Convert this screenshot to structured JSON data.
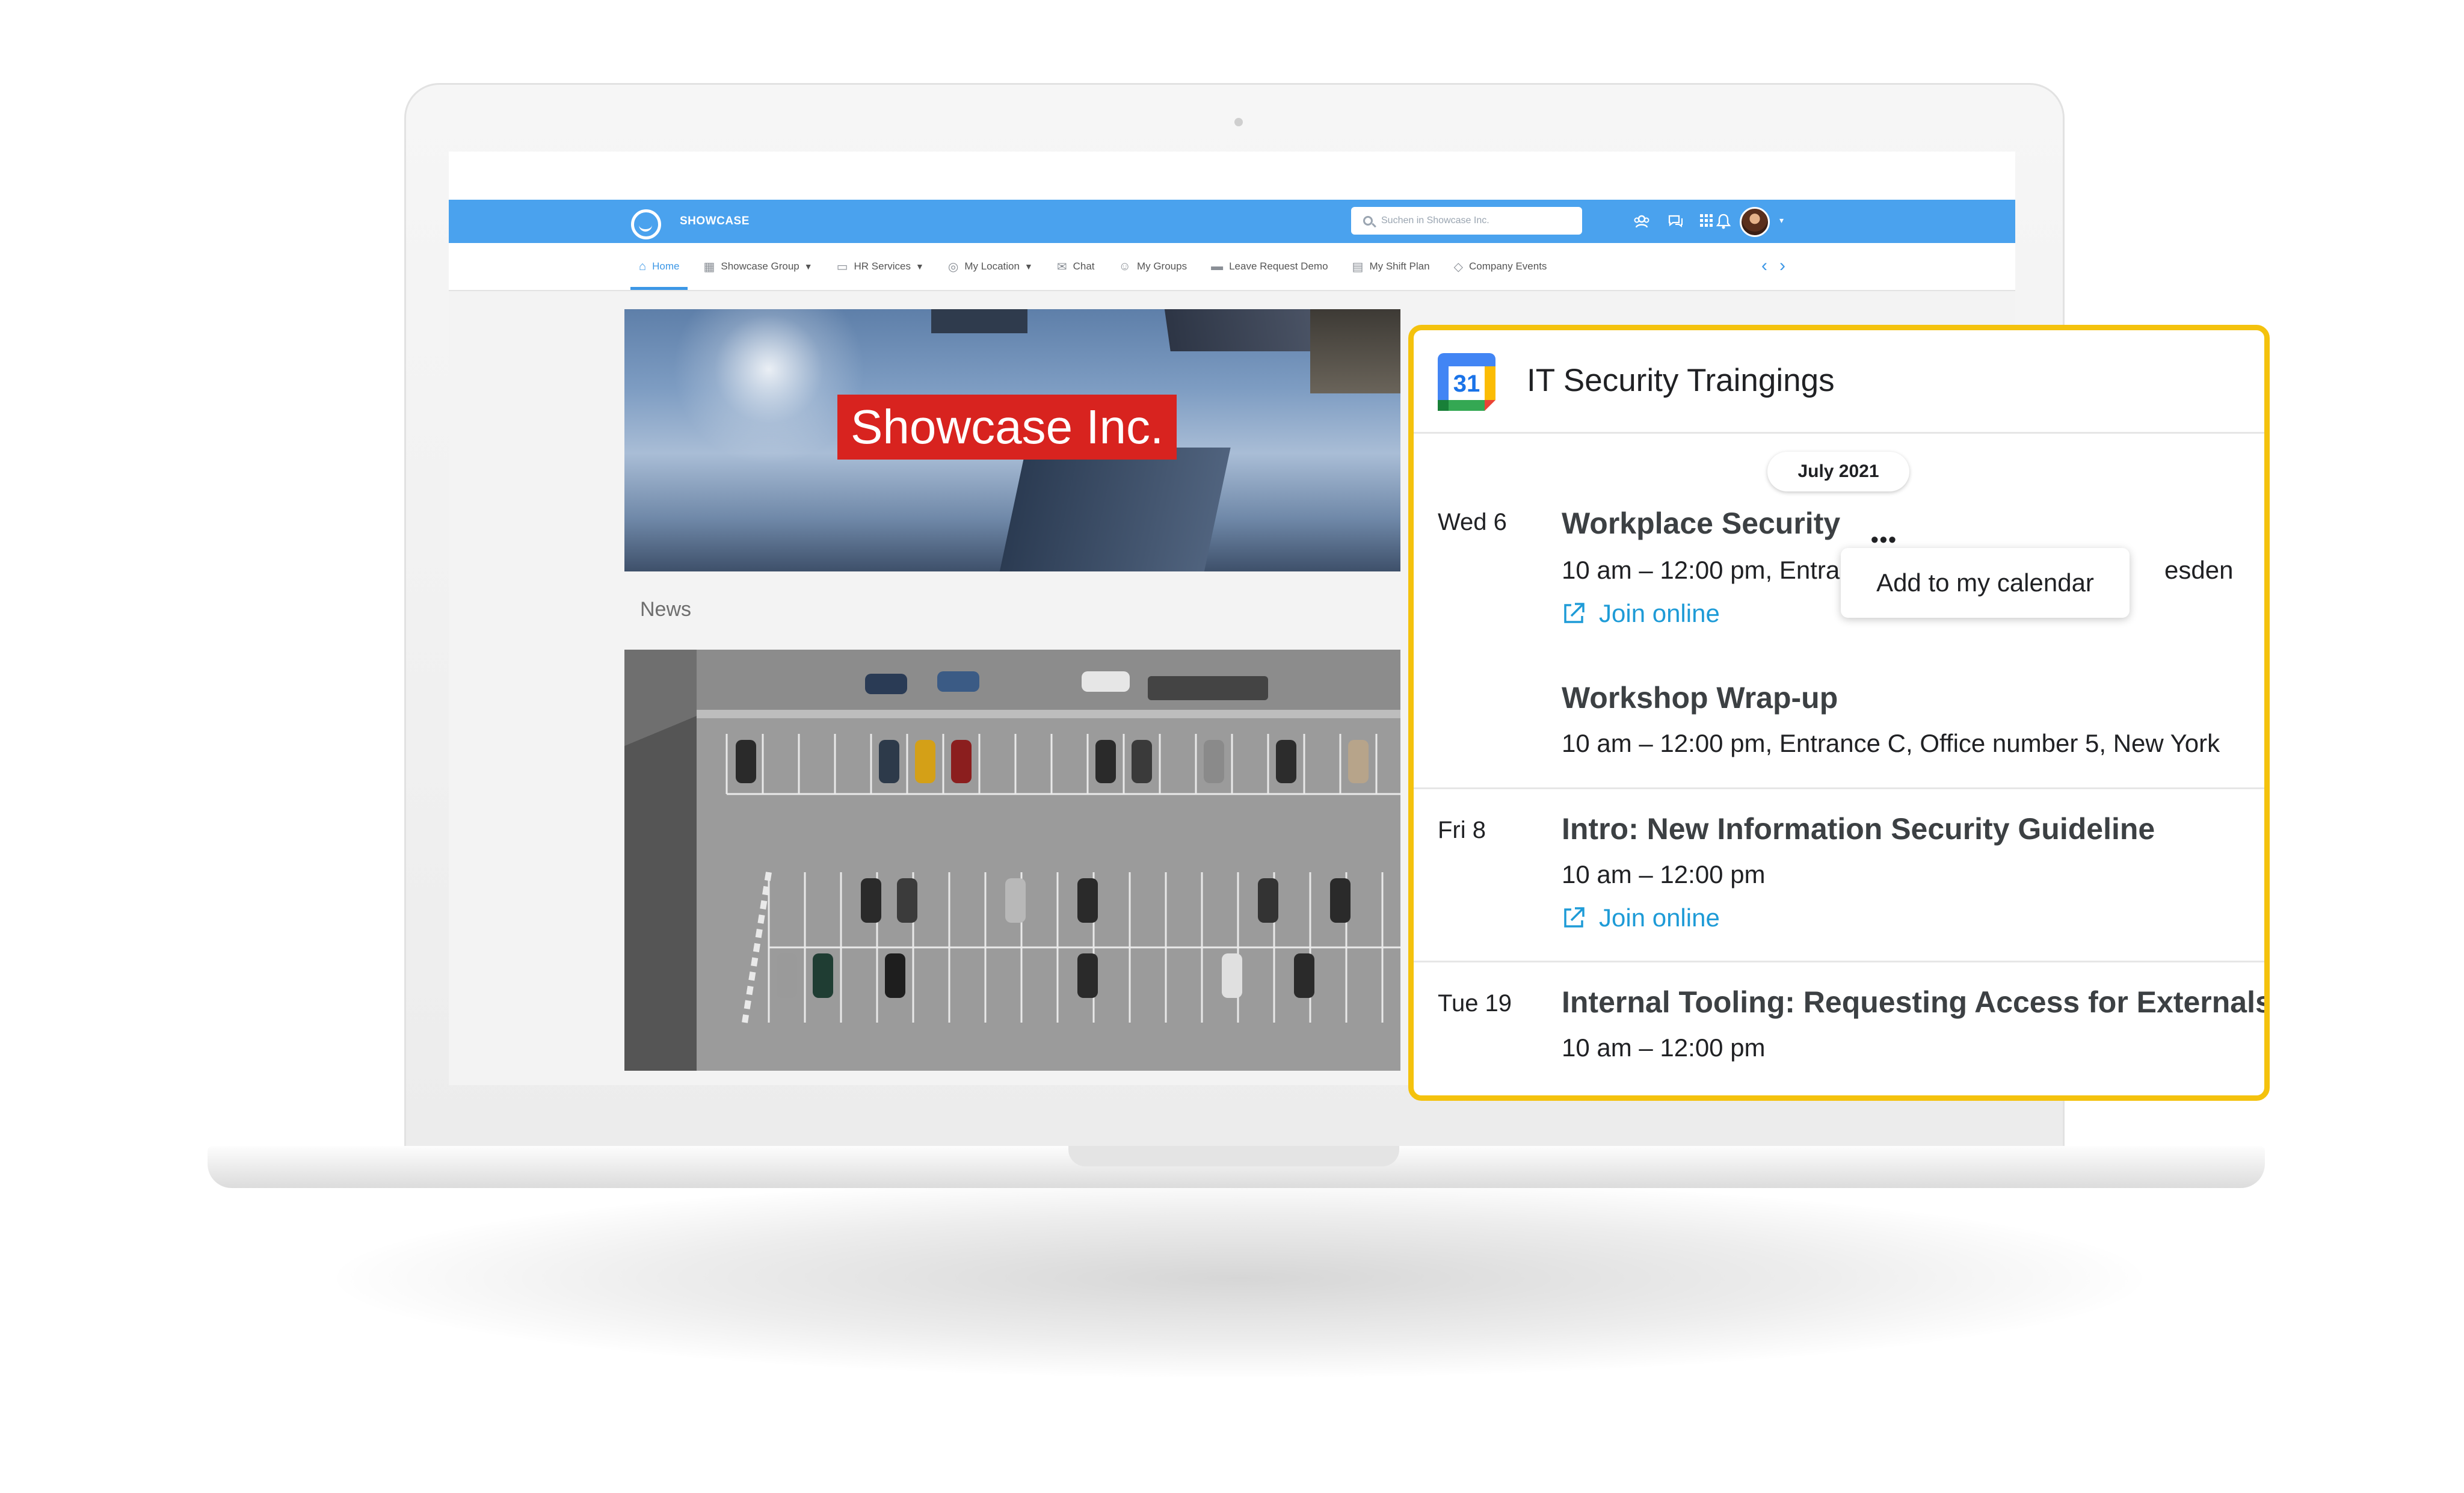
{
  "appbar": {
    "brand": "SHOWCASE",
    "search_placeholder": "Suchen in Showcase Inc.",
    "icons": [
      "groups-icon",
      "chat-icon",
      "apps-grid-icon",
      "bell-icon"
    ]
  },
  "nav": {
    "items": [
      {
        "label": "Home",
        "icon": "home-icon",
        "active": true
      },
      {
        "label": "Showcase Group",
        "icon": "building-icon",
        "caret": true
      },
      {
        "label": "HR Services",
        "icon": "folder-icon",
        "caret": true
      },
      {
        "label": "My Location",
        "icon": "globe-icon",
        "caret": true
      },
      {
        "label": "Chat",
        "icon": "chat-icon"
      },
      {
        "label": "My Groups",
        "icon": "groups-icon"
      },
      {
        "label": "Leave Request Demo",
        "icon": "inbox-icon"
      },
      {
        "label": "My Shift Plan",
        "icon": "calendar-icon"
      },
      {
        "label": "Company Events",
        "icon": "tag-icon"
      }
    ],
    "prev": "‹",
    "next": "›"
  },
  "hero": {
    "title": "Showcase Inc."
  },
  "news": {
    "label": "News"
  },
  "widget": {
    "title": "IT Security Traingings",
    "calendar_icon_number": "31",
    "month": "July 2021",
    "more_glyph": "•••",
    "menu_item": "Add to my calendar",
    "join_label": "Join online",
    "days": [
      {
        "day": "Wed 6",
        "events": [
          {
            "title": "Workplace Security",
            "detail_visible_left": "10 am – 12:00 pm, Entra",
            "detail_visible_right": "esden",
            "join": true
          },
          {
            "title": "Workshop Wrap-up",
            "detail": "10 am – 12:00 pm, Entrance C, Office number 5, New York",
            "join": false
          }
        ]
      },
      {
        "day": "Fri 8",
        "events": [
          {
            "title": "Intro: New Information Security Guideline",
            "detail": "10 am – 12:00 pm",
            "join": true
          }
        ]
      },
      {
        "day": "Tue 19",
        "events": [
          {
            "title": "Internal Tooling: Requesting Access for Externals",
            "detail": "10 am – 12:00 pm",
            "join": false
          }
        ]
      }
    ]
  },
  "colors": {
    "appbar": "#4aa2ee",
    "nav_active": "#3c97e6",
    "hero_banner": "#d8231f",
    "widget_border": "#f4c20d",
    "link": "#1e9bd7"
  }
}
